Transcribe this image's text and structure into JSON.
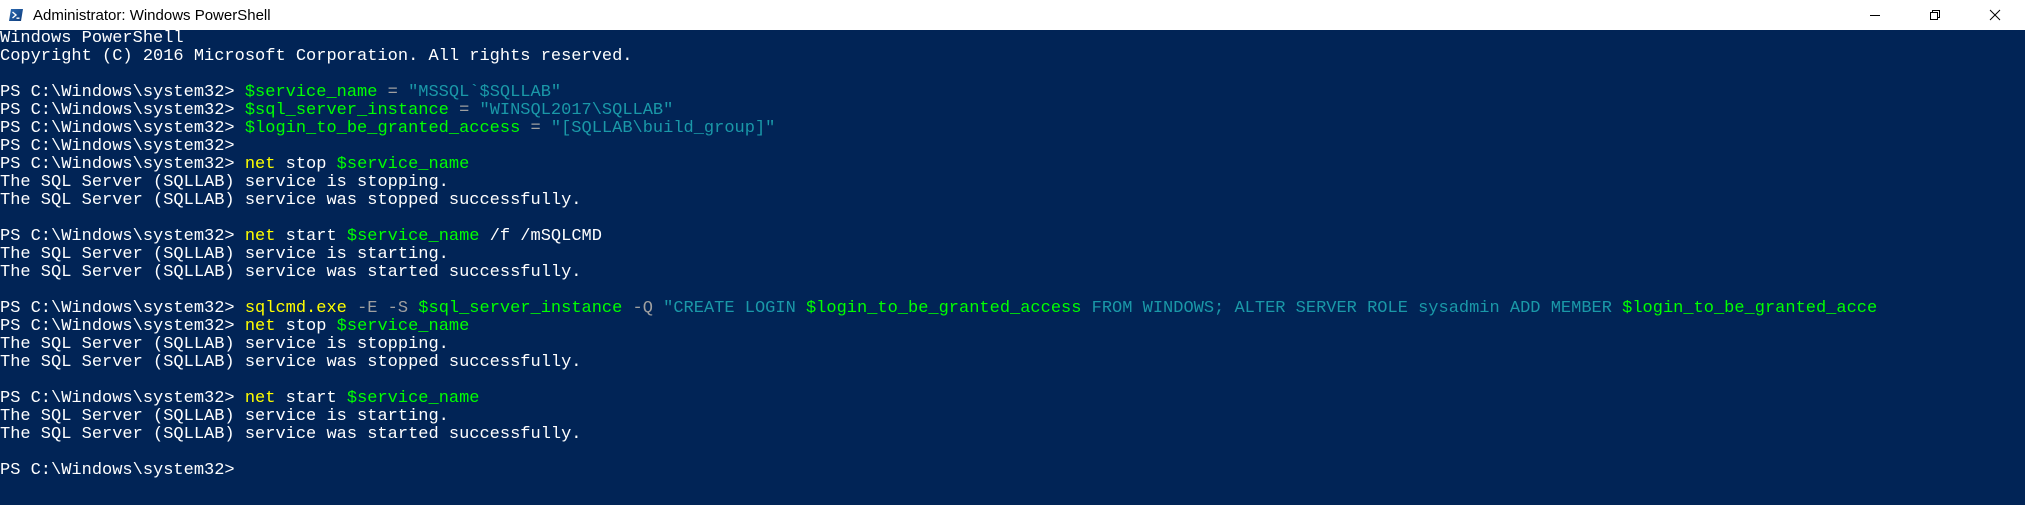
{
  "window": {
    "title": "Administrator: Windows PowerShell",
    "icon": "powershell-icon",
    "controls": [
      "minimize-icon",
      "restore-icon",
      "close-icon"
    ],
    "background": "#012456"
  },
  "colors": {
    "default": "#ffffff",
    "command": "#ffff00",
    "variable": "#00ff00",
    "string": "#1a98a8",
    "operator": "#a0a0a0"
  },
  "console": {
    "lines": [
      [
        {
          "t": "Windows PowerShell",
          "c": "default"
        }
      ],
      [
        {
          "t": "Copyright (C) 2016 Microsoft Corporation. All rights reserved.",
          "c": "default"
        }
      ],
      [],
      [
        {
          "t": "PS C:\\Windows\\system32> ",
          "c": "default"
        },
        {
          "t": "$service_name",
          "c": "var"
        },
        {
          "t": " = ",
          "c": "op"
        },
        {
          "t": "\"MSSQL`$SQLLAB\"",
          "c": "str"
        }
      ],
      [
        {
          "t": "PS C:\\Windows\\system32> ",
          "c": "default"
        },
        {
          "t": "$sql_server_instance",
          "c": "var"
        },
        {
          "t": " = ",
          "c": "op"
        },
        {
          "t": "\"WINSQL2017\\SQLLAB\"",
          "c": "str"
        }
      ],
      [
        {
          "t": "PS C:\\Windows\\system32> ",
          "c": "default"
        },
        {
          "t": "$login_to_be_granted_access",
          "c": "var"
        },
        {
          "t": " = ",
          "c": "op"
        },
        {
          "t": "\"[SQLLAB\\build_group]\"",
          "c": "str"
        }
      ],
      [
        {
          "t": "PS C:\\Windows\\system32>",
          "c": "default"
        }
      ],
      [
        {
          "t": "PS C:\\Windows\\system32> ",
          "c": "default"
        },
        {
          "t": "net",
          "c": "cmd"
        },
        {
          "t": " stop ",
          "c": "arg"
        },
        {
          "t": "$service_name",
          "c": "var"
        }
      ],
      [
        {
          "t": "The SQL Server (SQLLAB) service is stopping.",
          "c": "default"
        }
      ],
      [
        {
          "t": "The SQL Server (SQLLAB) service was stopped successfully.",
          "c": "default"
        }
      ],
      [],
      [
        {
          "t": "PS C:\\Windows\\system32> ",
          "c": "default"
        },
        {
          "t": "net",
          "c": "cmd"
        },
        {
          "t": " start ",
          "c": "arg"
        },
        {
          "t": "$service_name",
          "c": "var"
        },
        {
          "t": " /f /mSQLCMD",
          "c": "arg"
        }
      ],
      [
        {
          "t": "The SQL Server (SQLLAB) service is starting.",
          "c": "default"
        }
      ],
      [
        {
          "t": "The SQL Server (SQLLAB) service was started successfully.",
          "c": "default"
        }
      ],
      [],
      [
        {
          "t": "PS C:\\Windows\\system32> ",
          "c": "default"
        },
        {
          "t": "sqlcmd.exe",
          "c": "cmd"
        },
        {
          "t": " -E -S ",
          "c": "op"
        },
        {
          "t": "$sql_server_instance",
          "c": "var"
        },
        {
          "t": " -Q ",
          "c": "op"
        },
        {
          "t": "\"CREATE LOGIN ",
          "c": "str"
        },
        {
          "t": "$login_to_be_granted_access",
          "c": "var"
        },
        {
          "t": " FROM WINDOWS; ALTER SERVER ROLE sysadmin ADD MEMBER ",
          "c": "str"
        },
        {
          "t": "$login_to_be_granted_acce",
          "c": "var"
        }
      ],
      [
        {
          "t": "PS C:\\Windows\\system32> ",
          "c": "default"
        },
        {
          "t": "net",
          "c": "cmd"
        },
        {
          "t": " stop ",
          "c": "arg"
        },
        {
          "t": "$service_name",
          "c": "var"
        }
      ],
      [
        {
          "t": "The SQL Server (SQLLAB) service is stopping.",
          "c": "default"
        }
      ],
      [
        {
          "t": "The SQL Server (SQLLAB) service was stopped successfully.",
          "c": "default"
        }
      ],
      [],
      [
        {
          "t": "PS C:\\Windows\\system32> ",
          "c": "default"
        },
        {
          "t": "net",
          "c": "cmd"
        },
        {
          "t": " start ",
          "c": "arg"
        },
        {
          "t": "$service_name",
          "c": "var"
        }
      ],
      [
        {
          "t": "The SQL Server (SQLLAB) service is starting.",
          "c": "default"
        }
      ],
      [
        {
          "t": "The SQL Server (SQLLAB) service was started successfully.",
          "c": "default"
        }
      ],
      [],
      [
        {
          "t": "PS C:\\Windows\\system32>",
          "c": "default"
        }
      ]
    ]
  }
}
